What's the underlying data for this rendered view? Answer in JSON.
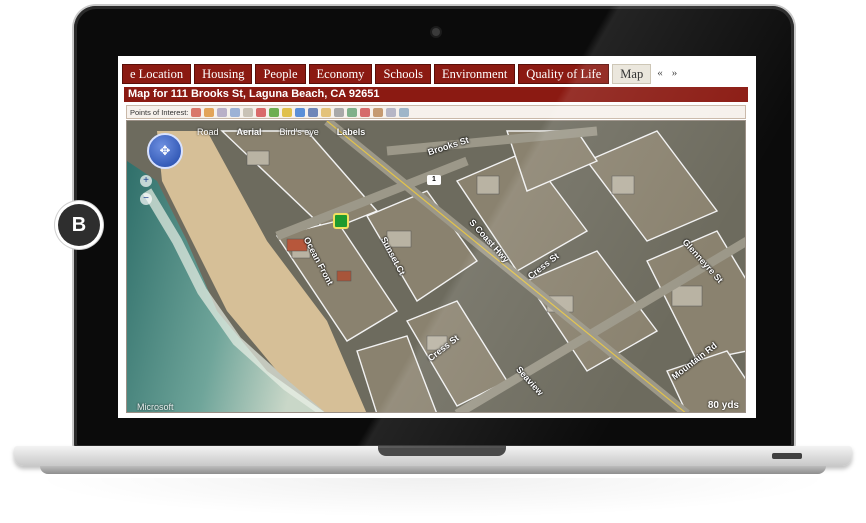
{
  "badge": "B",
  "tabs": [
    {
      "label": "e Location"
    },
    {
      "label": "Housing"
    },
    {
      "label": "People"
    },
    {
      "label": "Economy"
    },
    {
      "label": "Schools"
    },
    {
      "label": "Environment"
    },
    {
      "label": "Quality of Life"
    },
    {
      "label": "Map"
    }
  ],
  "tab_nav": {
    "prev": "«",
    "next": "»"
  },
  "map_title": "Map for 111 Brooks St, Laguna Beach, CA 92651",
  "poi_label": "Points of Interest:",
  "map_modes": {
    "road": "Road",
    "aerial": "Aerial",
    "birds_eye": "Bird's eye",
    "labels": "Labels"
  },
  "streets": {
    "brooks": "Brooks St",
    "coast_hwy": "S Coast Hwy",
    "cress_a": "Cress St",
    "cress_b": "Cress St",
    "glenneyre": "Glenneyre St",
    "mountain": "Mountain Rd",
    "ocean_front": "Ocean Front",
    "sunset": "Sunset Ct",
    "seaview": "Seaview"
  },
  "highway_shield": "1",
  "map_credit": "Microsoft",
  "scale_text": "80 yds",
  "colors": {
    "tab_red": "#8b1a12",
    "title_red": "#8b1a12",
    "compass_blue": "#1f47a8"
  }
}
